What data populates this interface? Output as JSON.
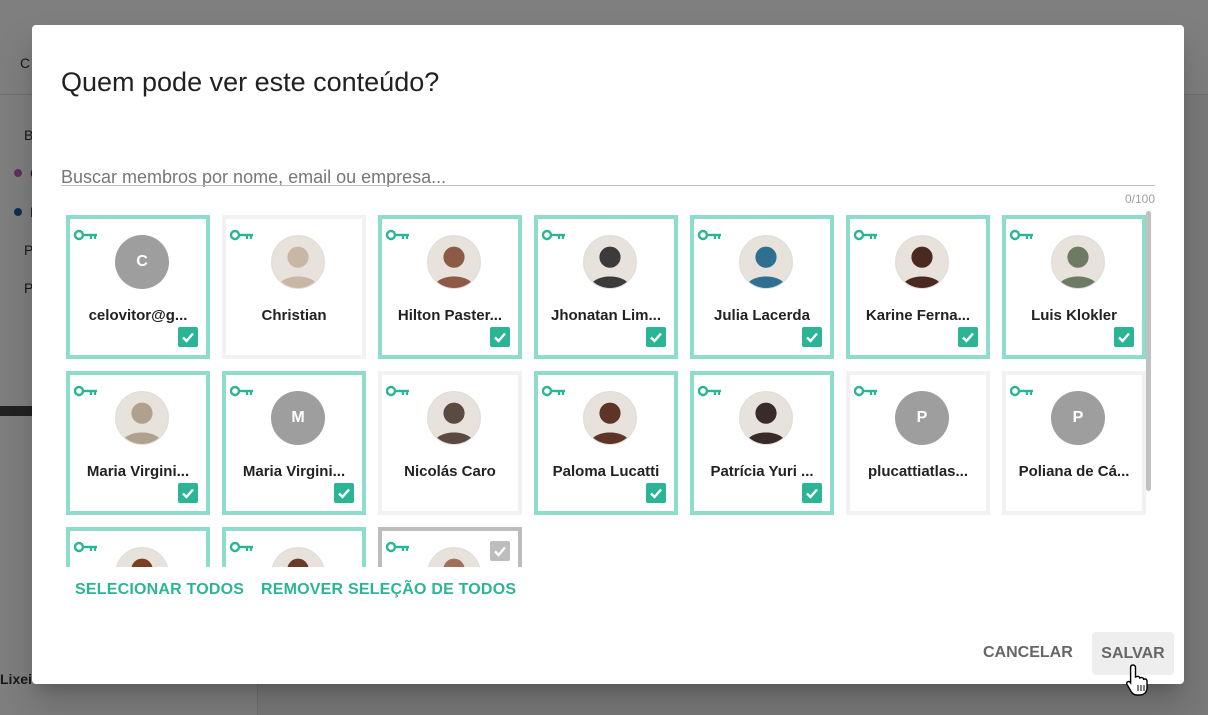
{
  "background": {
    "sidebar_items": [
      "C",
      "B",
      "C",
      "D",
      "P",
      "P"
    ],
    "trash_label": "Lixei"
  },
  "dialog": {
    "title": "Quem pode ver este conteúdo?",
    "search_placeholder": "Buscar membros por nome, email ou empresa...",
    "counter": "0/100",
    "select_all": "SELECIONAR TODOS",
    "deselect_all": "REMOVER SELEÇÃO DE TODOS",
    "cancel": "CANCELAR",
    "save": "SALVAR"
  },
  "accent_color": "#2bb596",
  "selected_border_color": "#8edccc",
  "members": [
    {
      "name": "celovitor@g...",
      "initial": "C",
      "selected": true,
      "key": true
    },
    {
      "name": "Christian",
      "photo": "#c9b7a6",
      "selected": false,
      "key": true
    },
    {
      "name": "Hilton Paster...",
      "photo": "#8d5a45",
      "selected": true,
      "key": true
    },
    {
      "name": "Jhonatan Lim...",
      "photo": "#3b3b3b",
      "selected": true,
      "key": true
    },
    {
      "name": "Julia Lacerda",
      "photo": "#2f6f8f",
      "selected": true,
      "key": true
    },
    {
      "name": "Karine Ferna...",
      "photo": "#4a2a20",
      "selected": true,
      "key": true
    },
    {
      "name": "Luis Klokler",
      "photo": "#6d7b64",
      "selected": true,
      "key": true
    },
    {
      "name": "Maria Virgini...",
      "photo": "#b0a08e",
      "selected": true,
      "key": true
    },
    {
      "name": "Maria Virgini...",
      "initial": "M",
      "selected": true,
      "key": true
    },
    {
      "name": "Nicolás Caro",
      "photo": "#5a4a40",
      "selected": false,
      "key": true
    },
    {
      "name": "Paloma Lucatti",
      "photo": "#5e3426",
      "selected": true,
      "key": true
    },
    {
      "name": "Patrícia Yuri ...",
      "photo": "#3a2a2a",
      "selected": true,
      "key": true
    },
    {
      "name": "plucattiatlas...",
      "initial": "P",
      "selected": false,
      "key": true
    },
    {
      "name": "Poliana de Cá...",
      "initial": "P",
      "selected": false,
      "key": true
    },
    {
      "name": "",
      "photo": "#7a3e20",
      "selected": true,
      "key": true
    },
    {
      "name": "",
      "photo": "#6b3a26",
      "selected": true,
      "key": true
    },
    {
      "name": "",
      "photo": "#a0705a",
      "selected": false,
      "greyed": true,
      "key": true
    }
  ]
}
